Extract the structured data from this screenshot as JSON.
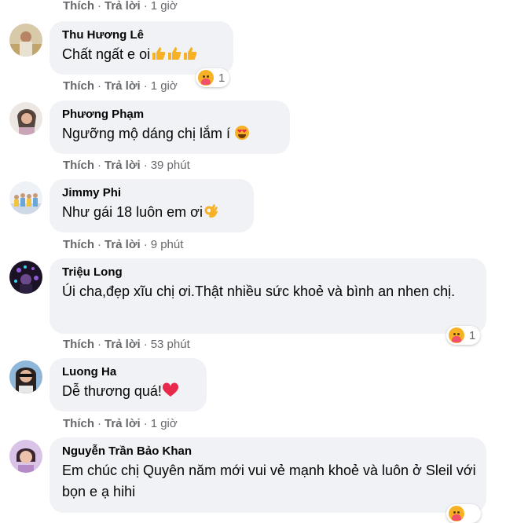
{
  "comments": [
    {
      "name": "",
      "text": "",
      "time": "1 giờ",
      "reaction_count": ""
    },
    {
      "name": "Thu Hương Lê",
      "text": "Chất ngất e oi",
      "emoji": "thumbs-up-icon",
      "time": "1 giờ",
      "reaction_count": "1"
    },
    {
      "name": "Phương Phạm",
      "text": "Ngưỡng mộ dáng chị lắm í ",
      "emoji": "heart-eyes-icon",
      "time": "39 phút",
      "reaction_count": ""
    },
    {
      "name": "Jimmy Phi",
      "text": "Như gái 18 luôn em ơi",
      "emoji": "ok-hand-icon",
      "time": "9 phút",
      "reaction_count": ""
    },
    {
      "name": "Triệu Long",
      "text": "Úi cha,đẹp xĩu chị ơi.Thật nhiều sức khoẻ và bình an nhen chị.",
      "time": "53 phút",
      "reaction_count": "1"
    },
    {
      "name": "Luong Ha",
      "text": "Dễ thương quá!",
      "emoji": "red-heart-icon",
      "time": "1 giờ",
      "reaction_count": ""
    },
    {
      "name": "Nguyễn Trần Bảo Khan",
      "text": "Em chúc chị Quyên năm mới vui vẻ mạnh khoẻ và luôn ở Sleil với bọn e ạ hihi",
      "time": "",
      "reaction_count": ""
    }
  ],
  "labels": {
    "like": "Thích",
    "reply": "Trả lời",
    "sep": "·"
  },
  "colors": {
    "bubble": "#f0f2f5",
    "meta": "#65676b",
    "text": "#050505"
  }
}
